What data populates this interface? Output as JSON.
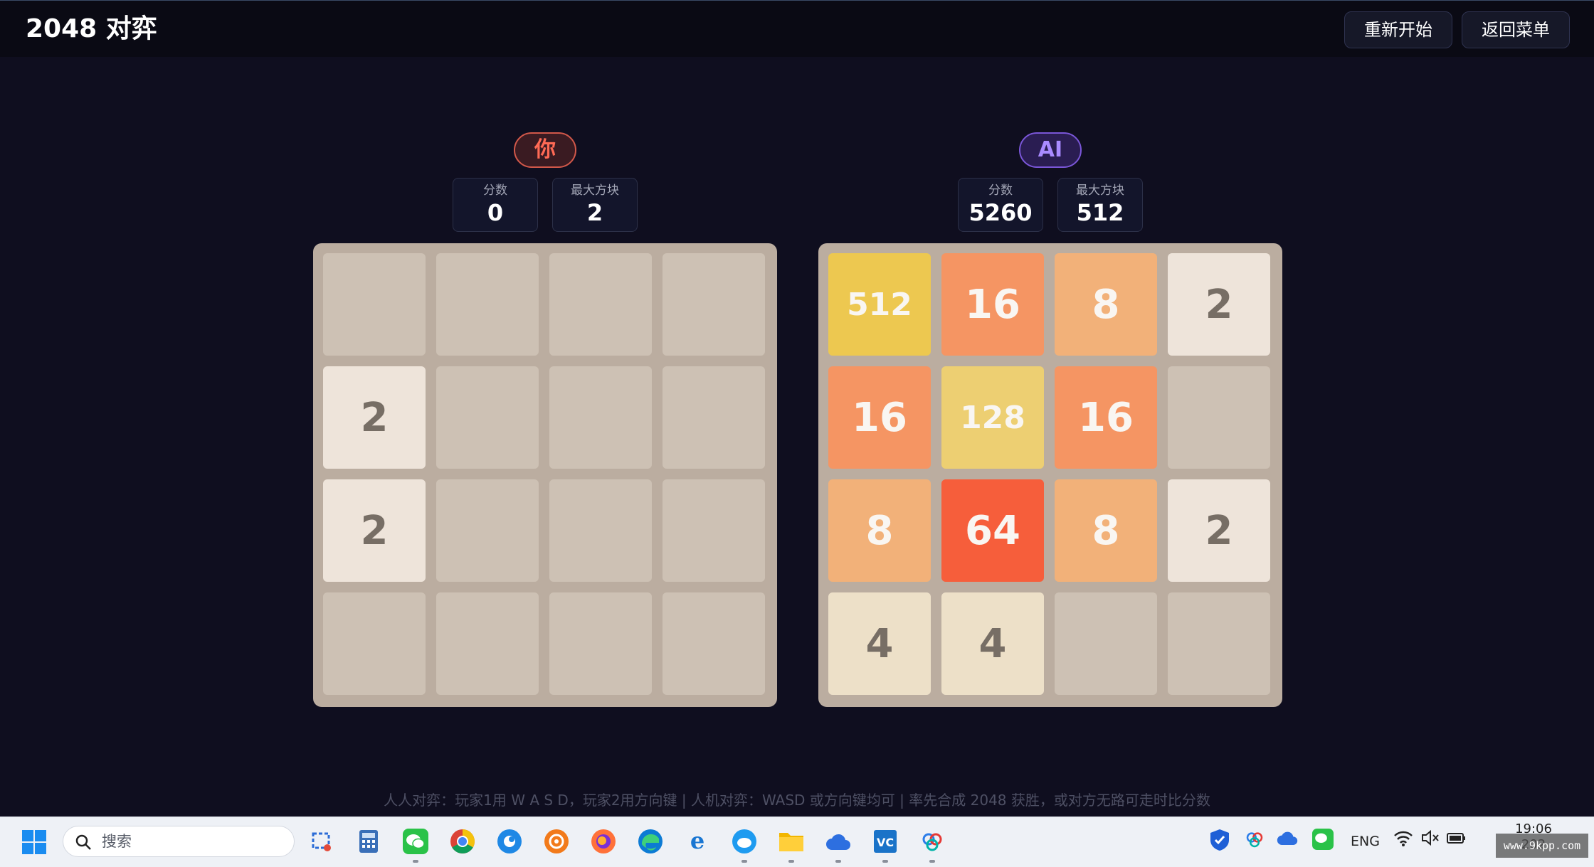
{
  "header": {
    "title": "2048 对弈",
    "restart_label": "重新开始",
    "menu_label": "返回菜单"
  },
  "players": [
    {
      "name": "你",
      "score_label": "分数",
      "score": "0",
      "max_tile_label": "最大方块",
      "max_tile": "2",
      "board": [
        [
          0,
          0,
          0,
          0
        ],
        [
          2,
          0,
          0,
          0
        ],
        [
          2,
          0,
          0,
          0
        ],
        [
          0,
          0,
          0,
          0
        ]
      ]
    },
    {
      "name": "AI",
      "score_label": "分数",
      "score": "5260",
      "max_tile_label": "最大方块",
      "max_tile": "512",
      "board": [
        [
          512,
          16,
          8,
          2
        ],
        [
          16,
          128,
          16,
          0
        ],
        [
          8,
          64,
          8,
          2
        ],
        [
          4,
          4,
          0,
          0
        ]
      ]
    }
  ],
  "footer": {
    "hint": "人人对弈：玩家1用 W A S D，玩家2用方向键 | 人机对弈：WASD 或方向键均可 | 率先合成 2048 获胜，或对方无路可走时比分数"
  },
  "taskbar": {
    "search_placeholder": "搜索",
    "apps": [
      "snipping-tool-icon",
      "calculator-icon",
      "wechat-icon",
      "chrome-icon",
      "browser-icon",
      "ucloud-icon",
      "firefox-icon",
      "edge-icon",
      "ie-icon",
      "cloud-browser-icon",
      "file-explorer-icon",
      "cloud-drive-icon",
      "vscode-icon",
      "baidu-netdisk-icon"
    ],
    "tray": {
      "language": "ENG",
      "time": "19:06",
      "date": "202"
    }
  },
  "watermark": "www.9kpp.com"
}
